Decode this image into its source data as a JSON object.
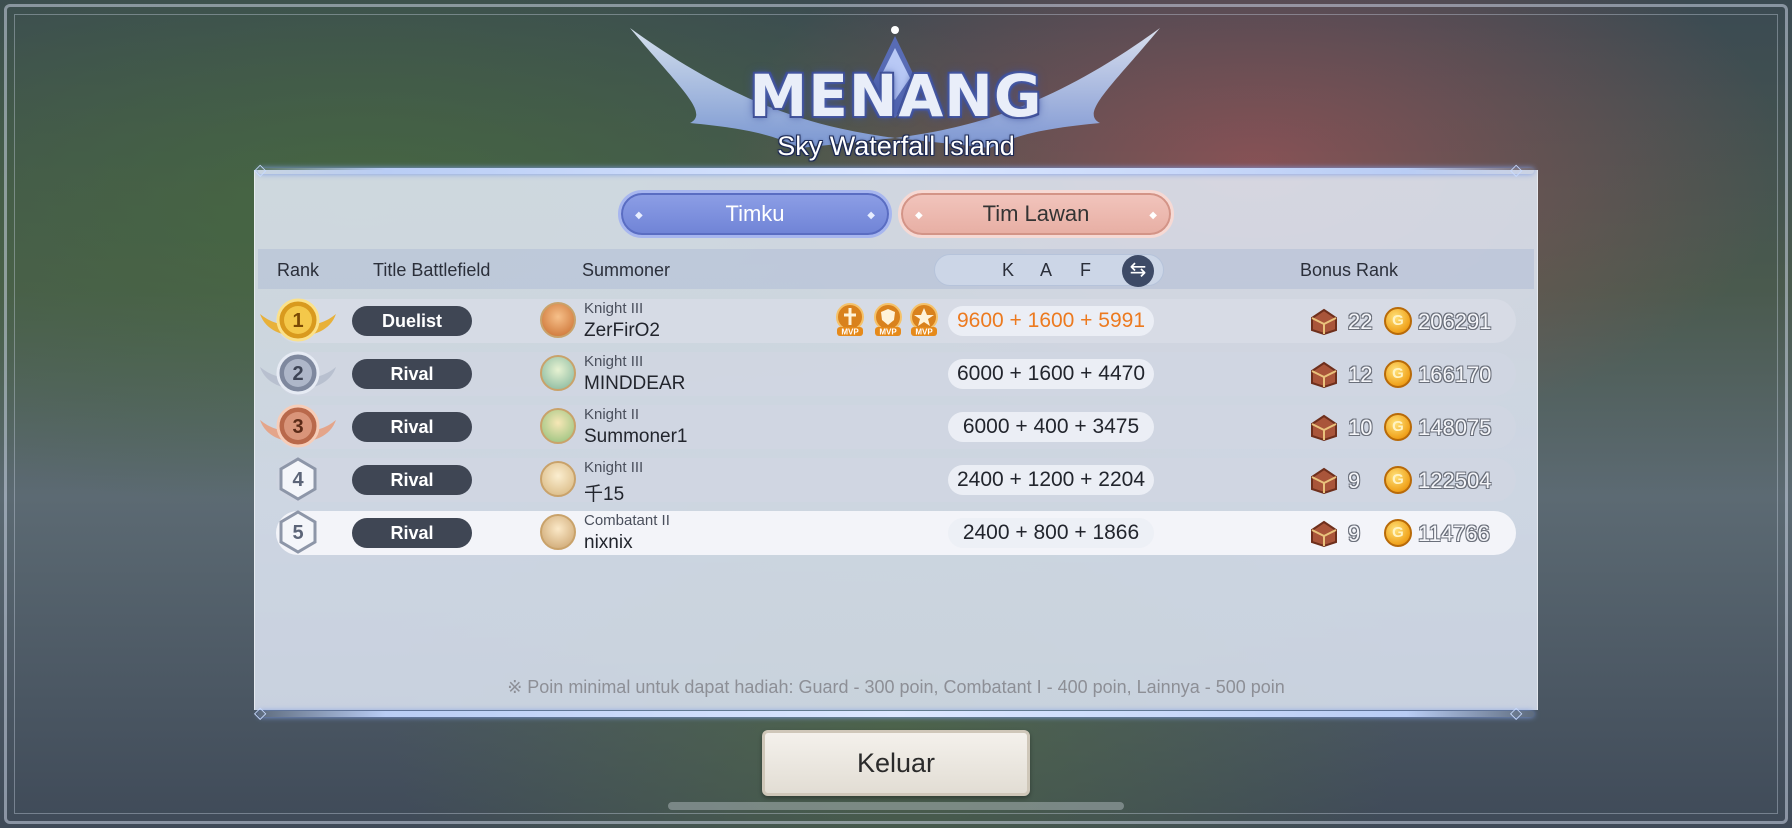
{
  "header": {
    "title": "MENANG",
    "subtitle": "Sky Waterfall Island"
  },
  "tabs": {
    "my_team": "Timku",
    "enemy_team": "Tim Lawan"
  },
  "columns": {
    "rank": "Rank",
    "title": "Title Battlefield",
    "summoner": "Summoner",
    "k": "K",
    "a": "A",
    "f": "F",
    "bonus": "Bonus Rank"
  },
  "rows": [
    {
      "rank": "1",
      "title": "Duelist",
      "summoner_rank": "Knight III",
      "name": "ZerFirO2",
      "score": "9600 + 1600 + 5991",
      "chests": "22",
      "coins": "206291",
      "mvp": true
    },
    {
      "rank": "2",
      "title": "Rival",
      "summoner_rank": "Knight III",
      "name": "MINDDEAR",
      "score": "6000 + 1600 + 4470",
      "chests": "12",
      "coins": "166170",
      "mvp": false
    },
    {
      "rank": "3",
      "title": "Rival",
      "summoner_rank": "Knight II",
      "name": "Summoner1",
      "score": "6000 + 400 + 3475",
      "chests": "10",
      "coins": "148075",
      "mvp": false
    },
    {
      "rank": "4",
      "title": "Rival",
      "summoner_rank": "Knight III",
      "name": "千15",
      "score": "2400 + 1200 + 2204",
      "chests": "9",
      "coins": "122504",
      "mvp": false
    },
    {
      "rank": "5",
      "title": "Rival",
      "summoner_rank": "Combatant II",
      "name": "nixnix",
      "score": "2400 + 800 + 1866",
      "chests": "9",
      "coins": "114766",
      "mvp": false
    }
  ],
  "mvp_label": "MVP",
  "coin_symbol": "G",
  "footnote": "※ Poin minimal untuk dapat hadiah: Guard - 300 poin, Combatant I - 400 poin, Lainnya - 500 poin",
  "exit_button": "Keluar",
  "colors": {
    "tab_my": "#7d90de",
    "tab_enemy": "#ecb8ae",
    "mvp_score": "#ec7a1f",
    "gold": "#e8b13a",
    "silver": "#b8c0cf",
    "bronze": "#d9957a"
  },
  "icons": {
    "swap": "swap-arrows-icon",
    "chest": "treasure-chest-icon",
    "coin": "gold-coin-icon"
  }
}
